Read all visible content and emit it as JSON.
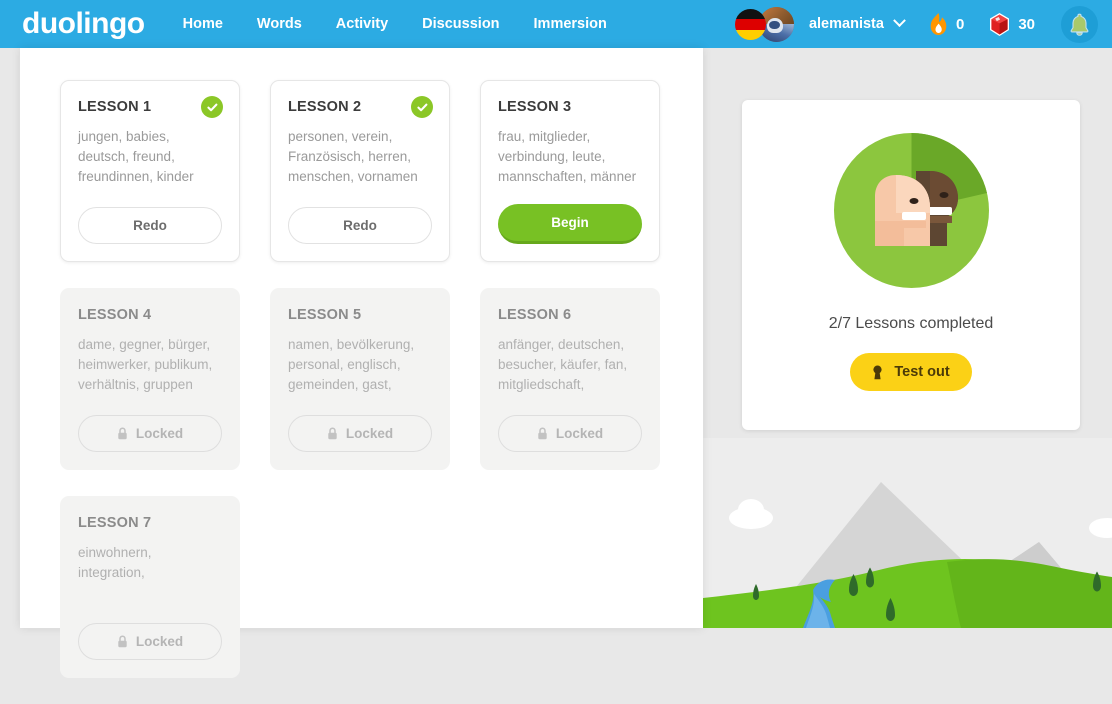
{
  "header": {
    "logo": "duolingo",
    "nav": [
      {
        "label": "Home"
      },
      {
        "label": "Words"
      },
      {
        "label": "Activity"
      },
      {
        "label": "Discussion"
      },
      {
        "label": "Immersion"
      }
    ],
    "username": "alemanista",
    "flag": "german-flag",
    "streak": {
      "icon": "flame-icon",
      "value": "0"
    },
    "gems": {
      "icon": "ruby-gem-icon",
      "value": "30"
    },
    "bell": "notification-bell-icon",
    "bg_color": "#2cabe3"
  },
  "lessons": [
    {
      "title": "LESSON 1",
      "words": "jungen, babies, deutsch, freund, freundinnen, kinder",
      "state": "completed",
      "button": "Redo",
      "badge": "check-icon"
    },
    {
      "title": "LESSON 2",
      "words": "personen, verein, Französisch, herren, menschen, vornamen",
      "state": "completed",
      "button": "Redo",
      "badge": "check-icon"
    },
    {
      "title": "LESSON 3",
      "words": "frau, mitglieder, verbindung, leute, mannschaften, männer",
      "state": "current",
      "button": "Begin",
      "badge": null
    },
    {
      "title": "LESSON 4",
      "words": "dame, gegner, bürger, heimwerker, publikum, verhältnis, gruppen",
      "state": "locked",
      "button": "Locked",
      "badge": null
    },
    {
      "title": "LESSON 5",
      "words": "namen, bevölkerung, personal, englisch, gemeinden, gast,",
      "state": "locked",
      "button": "Locked",
      "badge": null
    },
    {
      "title": "LESSON 6",
      "words": "anfänger, deutschen, besucher, käufer, fan, mitgliedschaft,",
      "state": "locked",
      "button": "Locked",
      "badge": null
    },
    {
      "title": "LESSON 7",
      "words": "einwohnern, integration,",
      "state": "locked",
      "button": "Locked",
      "badge": null
    }
  ],
  "skill_panel": {
    "icon": "people-skill-icon",
    "progress_label": "2/7 Lessons completed",
    "lessons_completed": 2,
    "lessons_total": 7,
    "test_out_label": "Test out",
    "test_out_icon": "keyhole-icon",
    "ring_color": "#8cc63e",
    "ring_progress_color": "#6aa828",
    "test_out_color": "#fbd116"
  },
  "decoration": {
    "scene": "mountain-landscape-illustration",
    "mountain_color": "#d5d5d5",
    "hill_color": "#6ec41f",
    "river_color": "#4a9fe0",
    "tree_color": "#2f6b2a",
    "cloud_color": "#ffffff"
  }
}
